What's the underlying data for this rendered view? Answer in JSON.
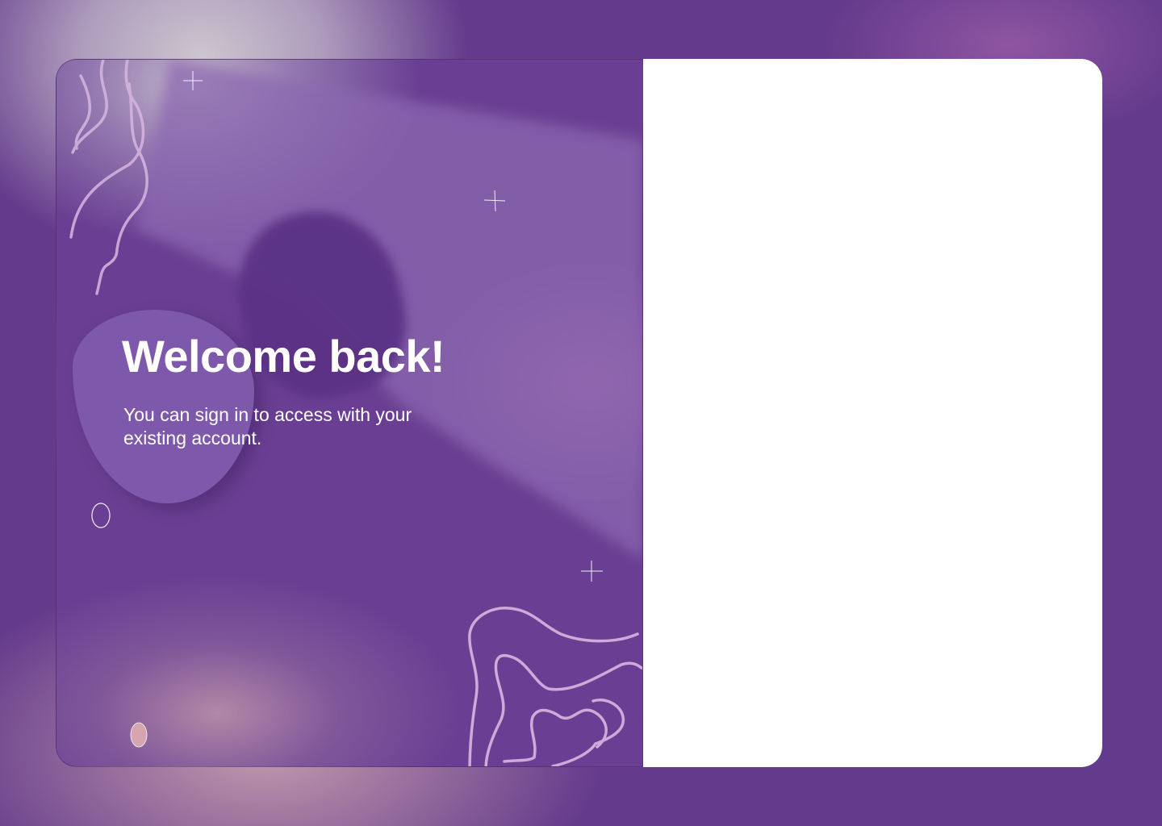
{
  "hero": {
    "title": "Welcome back!",
    "subtitle": "You can sign in to access with your existing account."
  },
  "colors": {
    "background": "#643a8c",
    "panel_base": "#6a3f93",
    "blob": "#7e58aa",
    "form_panel": "#ffffff",
    "text": "#ffffff",
    "line_art": "#d8b6e0"
  },
  "icons": [
    "sparkle-icon",
    "squiggle-line",
    "oval-outline"
  ]
}
